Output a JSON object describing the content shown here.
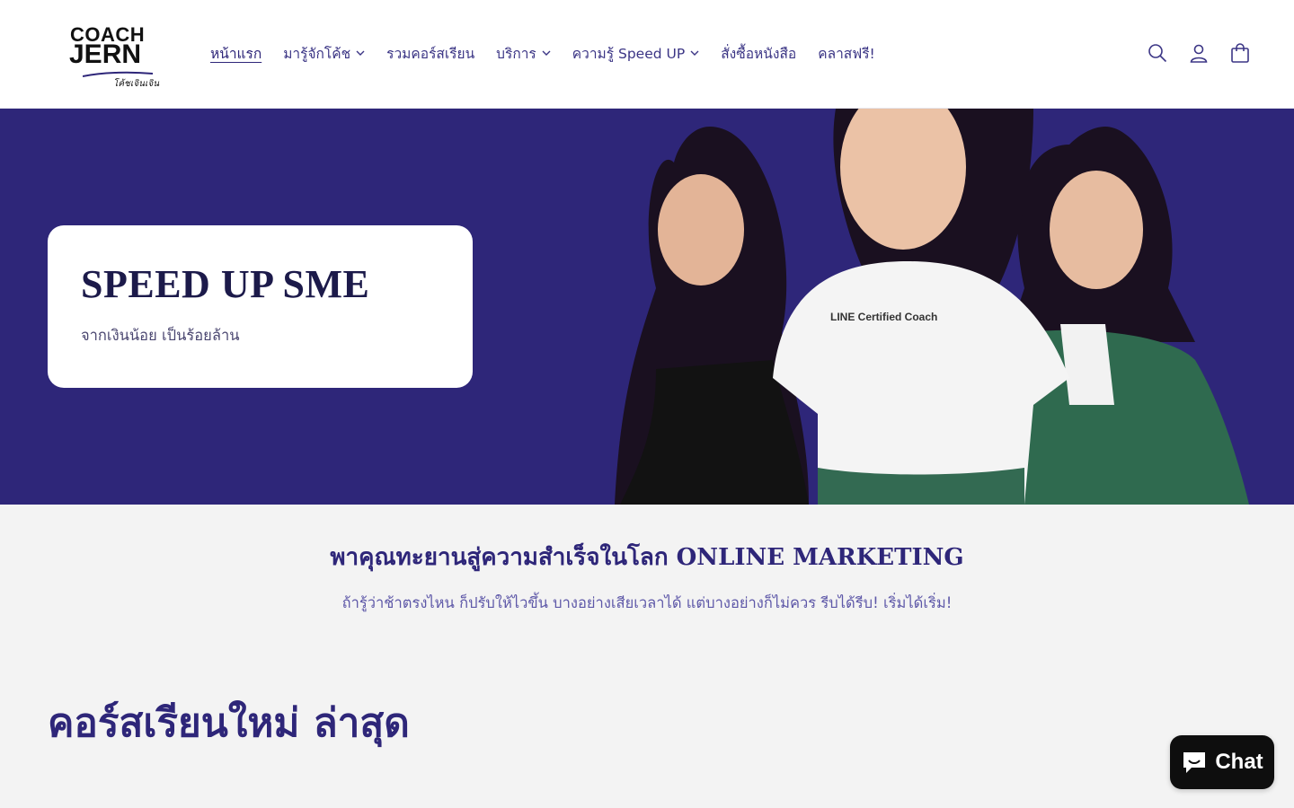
{
  "header": {
    "logo": {
      "line1": "COACH",
      "line2": "JERN",
      "tagline": "โค้ชเจินเจิน"
    },
    "nav": [
      {
        "label": "หน้าแรก",
        "active": true,
        "dropdown": false
      },
      {
        "label": "มารู้จักโค้ช",
        "active": false,
        "dropdown": true
      },
      {
        "label": "รวมคอร์สเรียน",
        "active": false,
        "dropdown": false
      },
      {
        "label": "บริการ",
        "active": false,
        "dropdown": true
      },
      {
        "label": "ความรู้ Speed UP",
        "active": false,
        "dropdown": true
      },
      {
        "label": "สั่งซื้อหนังสือ",
        "active": false,
        "dropdown": false
      },
      {
        "label": "คลาสฟรี!",
        "active": false,
        "dropdown": false
      }
    ],
    "icons": [
      "search-icon",
      "account-icon",
      "cart-icon"
    ]
  },
  "hero": {
    "title": "SPEED UP SME",
    "subtitle": "จากเงินน้อย เป็นร้อยล้าน",
    "shirt_text": "LINE Certified Coach",
    "background_color": "#2e2679"
  },
  "intro": {
    "title": "พาคุณทะยานสู่ความสำเร็จในโลก ONLINE MARKETING",
    "subtitle": "ถ้ารู้ว่าช้าตรงไหน ก็ปรับให้ไวขึ้น บางอย่างเสียเวลาได้ แต่บางอย่างก็ไม่ควร รีบได้รีบ! เริ่มได้เริ่ม!"
  },
  "courses": {
    "title": "คอร์สเรียนใหม่ ล่าสุด"
  },
  "chat": {
    "label": "Chat"
  },
  "colors": {
    "brand": "#2e2679",
    "card": "#ffffff",
    "page_bg": "#f3f3f3"
  }
}
